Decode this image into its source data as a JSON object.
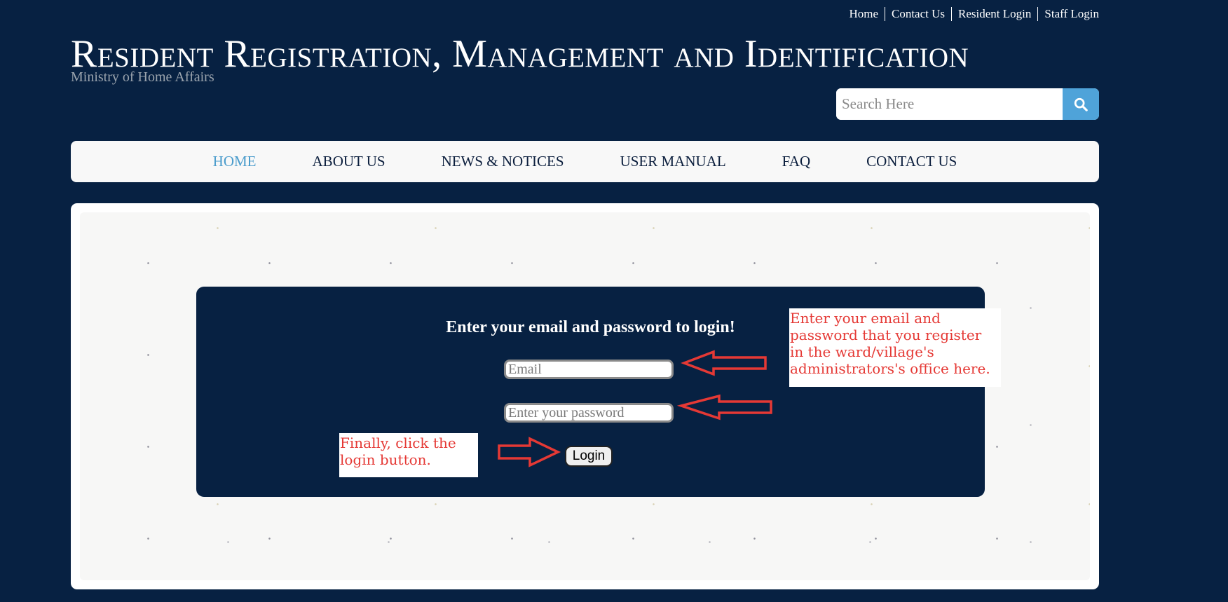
{
  "toplinks": {
    "home": "Home",
    "contact": "Contact Us",
    "resident_login": "Resident Login",
    "staff_login": "Staff Login"
  },
  "header": {
    "title": "Resident Registration, Management and Identification",
    "subtitle": "Ministry of Home Affairs"
  },
  "search": {
    "placeholder": "Search Here",
    "icon": "search-icon"
  },
  "nav": {
    "home": "HOME",
    "about": "ABOUT US",
    "news": "NEWS & NOTICES",
    "manual": "USER MANUAL",
    "faq": "FAQ",
    "contact": "CONTACT US"
  },
  "login": {
    "heading": "Enter your email and password to login!",
    "email_placeholder": "Email",
    "password_placeholder": "Enter your password",
    "button": "Login"
  },
  "annotations": {
    "right": "Enter your email and\npassword that you register\nin the ward/village's\nadministrators's office here.",
    "left": "Finally, click the\nlogin button."
  },
  "colors": {
    "background": "#072142",
    "nav_active": "#4a9ccc",
    "search_button": "#4fa3d9",
    "annotation": "#e53935"
  }
}
